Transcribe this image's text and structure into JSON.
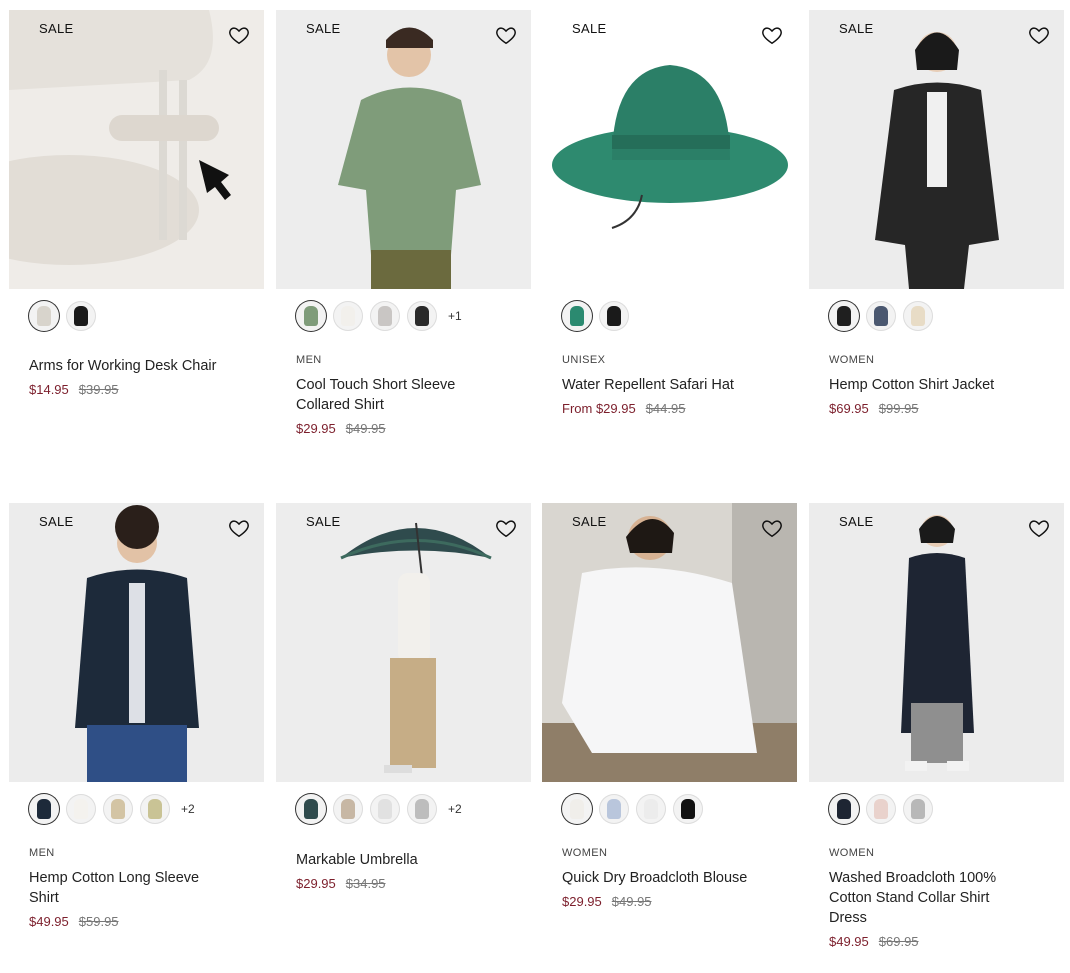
{
  "products": [
    {
      "badge": "SALE",
      "category": "",
      "name": "Arms for Working Desk Chair",
      "price": "$14.95",
      "orig": "$39.95",
      "more": "",
      "swatches": [
        {
          "color": "#d8d4cc"
        },
        {
          "color": "#1a1a1a"
        }
      ]
    },
    {
      "badge": "SALE",
      "category": "MEN",
      "name": "Cool Touch Short Sleeve Collared Shirt",
      "price": "$29.95",
      "orig": "$49.95",
      "more": "+1",
      "swatches": [
        {
          "color": "#7f9c7a"
        },
        {
          "color": "#f2f0ec"
        },
        {
          "color": "#c9c6c4"
        },
        {
          "color": "#2a2a2a"
        }
      ]
    },
    {
      "badge": "SALE",
      "category": "UNISEX",
      "name": "Water Repellent Safari Hat",
      "price": "From $29.95",
      "orig": "$44.95",
      "more": "",
      "swatches": [
        {
          "color": "#2b8a70"
        },
        {
          "color": "#1a1a1a"
        }
      ]
    },
    {
      "badge": "SALE",
      "category": "WOMEN",
      "name": "Hemp Cotton Shirt Jacket",
      "price": "$69.95",
      "orig": "$99.95",
      "more": "",
      "swatches": [
        {
          "color": "#1f1f1f"
        },
        {
          "color": "#4b5870"
        },
        {
          "color": "#e8dcc6"
        }
      ]
    },
    {
      "badge": "SALE",
      "category": "MEN",
      "name": "Hemp Cotton Long Sleeve Shirt",
      "price": "$49.95",
      "orig": "$59.95",
      "more": "+2",
      "swatches": [
        {
          "color": "#1d2a3a"
        },
        {
          "color": "#f4f2ee"
        },
        {
          "color": "#d3c4a4"
        },
        {
          "color": "#c9c395"
        }
      ]
    },
    {
      "badge": "SALE",
      "category": "",
      "name": "Markable Umbrella",
      "price": "$29.95",
      "orig": "$34.95",
      "more": "+2",
      "swatches": [
        {
          "color": "#2f4b4d"
        },
        {
          "color": "#c7b7a4"
        },
        {
          "color": "#e1e1e1"
        },
        {
          "color": "#bdbdbd"
        }
      ]
    },
    {
      "badge": "SALE",
      "category": "WOMEN",
      "name": "Quick Dry Broadcloth Blouse",
      "price": "$29.95",
      "orig": "$49.95",
      "more": "",
      "swatches": [
        {
          "color": "#f0eeea"
        },
        {
          "color": "#b9c6dc"
        },
        {
          "color": "#ececec"
        },
        {
          "color": "#111111"
        }
      ]
    },
    {
      "badge": "SALE",
      "category": "WOMEN",
      "name": "Washed Broadcloth 100% Cotton Stand Collar Shirt Dress",
      "price": "$49.95",
      "orig": "$69.95",
      "more": "",
      "swatches": [
        {
          "color": "#1e2533"
        },
        {
          "color": "#e9d2cc"
        },
        {
          "color": "#b8b8b8"
        }
      ]
    }
  ]
}
